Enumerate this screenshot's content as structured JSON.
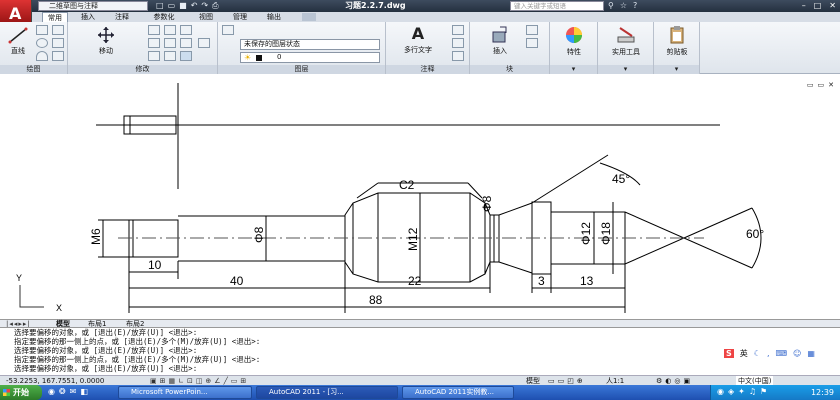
{
  "titlebar": {
    "workspace": "二维草图与注释",
    "file_title": "习题2.2.7.dwg",
    "search_placeholder": "键入关键字或短语"
  },
  "tabs": [
    {
      "label": "常用"
    },
    {
      "label": "插入"
    },
    {
      "label": "注释"
    },
    {
      "label": "参数化"
    },
    {
      "label": "视图"
    },
    {
      "label": "管理"
    },
    {
      "label": "输出"
    }
  ],
  "ribbon": {
    "draw": {
      "line_label": "直线",
      "panel": "绘图"
    },
    "modify": {
      "move_label": "移动",
      "panel": "修改"
    },
    "layers": {
      "state": "未保存的图层状态",
      "layer": "0",
      "panel": "图层"
    },
    "annotation": {
      "text_label": "多行文字",
      "panel": "注释"
    },
    "block": {
      "insert_label": "插入",
      "panel": "块"
    },
    "properties": {
      "label": "特性"
    },
    "utilities": {
      "label": "实用工具"
    },
    "clipboard": {
      "label": "剪贴板"
    }
  },
  "drawing": {
    "dims": {
      "chamfer": "C2",
      "angle45": "45°",
      "angle60": "60°",
      "d1": "M6",
      "d2": "Φ8",
      "d3": "M12",
      "d4": "Φ8",
      "d5": "Φ12",
      "d6": "Φ18",
      "l10": "10",
      "l40": "40",
      "l22": "22",
      "l3": "3",
      "l13": "13",
      "l88": "88"
    },
    "ucs": {
      "x": "X",
      "y": "Y"
    }
  },
  "layout_tabs": {
    "model": "模型",
    "layout1": "布局1",
    "layout2": "布局2"
  },
  "command_lines": [
    "选择要偏移的对象，或 [退出(E)/放弃(U)] <退出>:",
    "指定要偏移的那一侧上的点，或 [退出(E)/多个(M)/放弃(U)] <退出>:",
    "选择要偏移的对象，或 [退出(E)/放弃(U)] <退出>:",
    "指定要偏移的那一侧上的点，或 [退出(E)/多个(M)/放弃(U)] <退出>:",
    "选择要偏移的对象，或 [退出(E)/放弃(U)] <退出>:"
  ],
  "ime": {
    "lang": "英"
  },
  "statusbar": {
    "coords": "-53.2253, 167.7551, 0.0000",
    "model": "模型",
    "scale": "人1:1",
    "ime_status": "中文(中国)"
  },
  "taskbar": {
    "start": "开始",
    "tasks": [
      {
        "label": "Microsoft PowerPoin..."
      },
      {
        "label": "AutoCAD 2011 - [习..."
      },
      {
        "label": "AutoCAD 2011实例教..."
      }
    ],
    "clock": "12:39"
  },
  "colors": {
    "title_bg": "#2f3b4c",
    "ribbon_bg": "#e6ebf1",
    "taskbar": "#2a62c8",
    "start": "#3a9c36"
  }
}
